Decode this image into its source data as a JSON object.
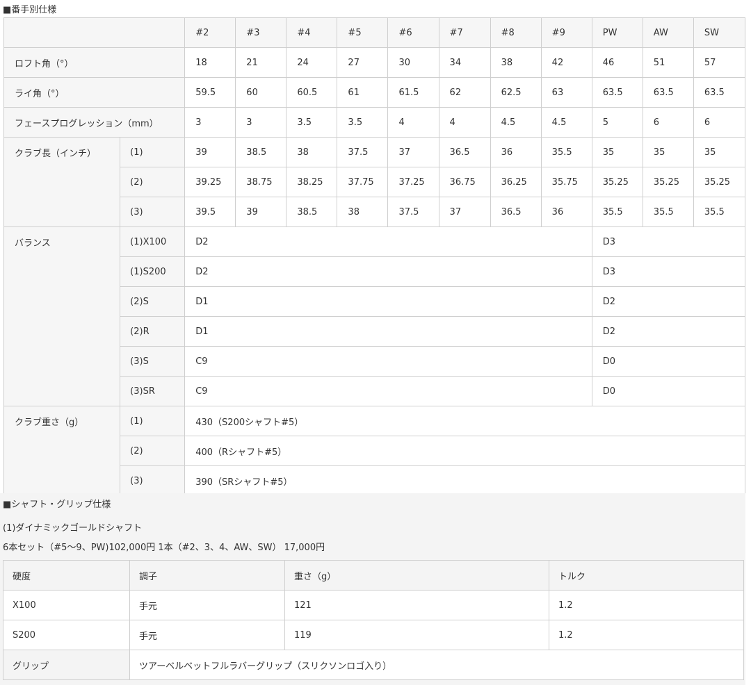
{
  "spec": {
    "title": "■番手別仕様",
    "headers": [
      "#2",
      "#3",
      "#4",
      "#5",
      "#6",
      "#7",
      "#8",
      "#9",
      "PW",
      "AW",
      "SW"
    ],
    "loft": {
      "label": "ロフト角（°）",
      "values": [
        "18",
        "21",
        "24",
        "27",
        "30",
        "34",
        "38",
        "42",
        "46",
        "51",
        "57"
      ]
    },
    "lie": {
      "label": "ライ角（°）",
      "values": [
        "59.5",
        "60",
        "60.5",
        "61",
        "61.5",
        "62",
        "62.5",
        "63",
        "63.5",
        "63.5",
        "63.5"
      ]
    },
    "progression": {
      "label": "フェースプログレッション（mm）",
      "values": [
        "3",
        "3",
        "3.5",
        "3.5",
        "4",
        "4",
        "4.5",
        "4.5",
        "5",
        "6",
        "6"
      ]
    },
    "length": {
      "label": "クラブ長（インチ）",
      "rows": [
        {
          "sub": "(1)",
          "values": [
            "39",
            "38.5",
            "38",
            "37.5",
            "37",
            "36.5",
            "36",
            "35.5",
            "35",
            "35",
            "35"
          ]
        },
        {
          "sub": "(2)",
          "values": [
            "39.25",
            "38.75",
            "38.25",
            "37.75",
            "37.25",
            "36.75",
            "36.25",
            "35.75",
            "35.25",
            "35.25",
            "35.25"
          ]
        },
        {
          "sub": "(3)",
          "values": [
            "39.5",
            "39",
            "38.5",
            "38",
            "37.5",
            "37",
            "36.5",
            "36",
            "35.5",
            "35.5",
            "35.5"
          ]
        }
      ]
    },
    "balance": {
      "label": "バランス",
      "rows": [
        {
          "sub": "(1)X100",
          "iron": "D2",
          "wedge": "D3"
        },
        {
          "sub": "(1)S200",
          "iron": "D2",
          "wedge": "D3"
        },
        {
          "sub": "(2)S",
          "iron": "D1",
          "wedge": "D2"
        },
        {
          "sub": "(2)R",
          "iron": "D1",
          "wedge": "D2"
        },
        {
          "sub": "(3)S",
          "iron": "C9",
          "wedge": "D0"
        },
        {
          "sub": "(3)SR",
          "iron": "C9",
          "wedge": "D0"
        }
      ]
    },
    "weight": {
      "label": "クラブ重さ（g）",
      "rows": [
        {
          "sub": "(1)",
          "value": "430（S200シャフト#5）"
        },
        {
          "sub": "(2)",
          "value": "400（Rシャフト#5）"
        },
        {
          "sub": "(3)",
          "value": "390（SRシャフト#5）"
        }
      ]
    }
  },
  "shaft": {
    "title": "■シャフト・グリップ仕様",
    "name": "(1)ダイナミックゴールドシャフト",
    "price": "6本セット（#5～9、PW)102,000円 1本（#2、3、4、AW、SW） 17,000円",
    "headers": [
      "硬度",
      "調子",
      "重さ（g）",
      "トルク"
    ],
    "rows": [
      [
        "X100",
        "手元",
        "121",
        "1.2"
      ],
      [
        "S200",
        "手元",
        "119",
        "1.2"
      ]
    ],
    "grip": {
      "label": "グリップ",
      "value": "ツアーベルベットフルラバーグリップ（スリクソンロゴ入り）"
    }
  }
}
